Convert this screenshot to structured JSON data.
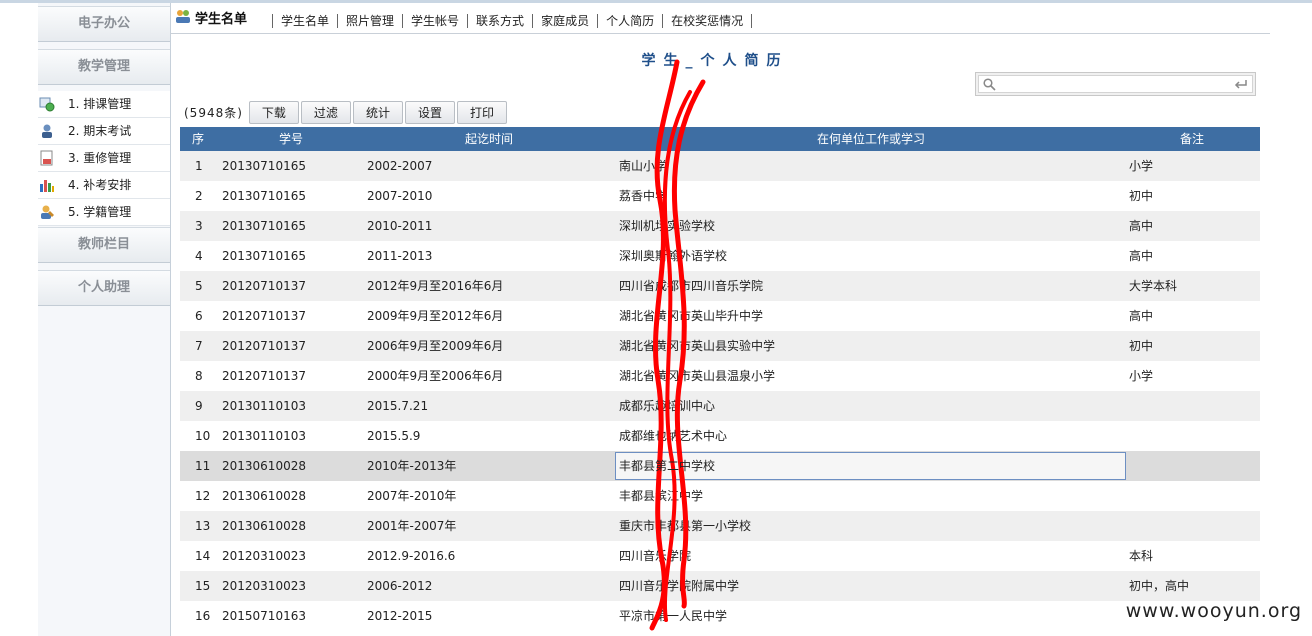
{
  "sidebar": {
    "sections": [
      {
        "label": "电子办公"
      },
      {
        "label": "教学管理"
      },
      {
        "label": "教师栏目"
      },
      {
        "label": "个人助理"
      }
    ],
    "items": [
      {
        "label": "1. 排课管理",
        "icon": "schedule-icon"
      },
      {
        "label": "2. 期末考试",
        "icon": "exam-icon"
      },
      {
        "label": "3. 重修管理",
        "icon": "document-icon"
      },
      {
        "label": "4. 补考安排",
        "icon": "bar-chart-icon"
      },
      {
        "label": "5. 学籍管理",
        "icon": "student-icon"
      }
    ]
  },
  "header": {
    "title": "学生名单",
    "tabs": [
      "学生名单",
      "照片管理",
      "学生帐号",
      "联系方式",
      "家庭成员",
      "个人简历",
      "在校奖惩情况"
    ]
  },
  "page_heading": "学生_个人简历",
  "search": {
    "placeholder": "",
    "value": ""
  },
  "toolbar": {
    "count": "(5948条)",
    "buttons": [
      "下载",
      "过滤",
      "统计",
      "设置",
      "打印"
    ]
  },
  "table": {
    "columns": [
      "序",
      "学号",
      "起讫时间",
      "在何单位工作或学习",
      "备注"
    ],
    "rows": [
      {
        "no": "1",
        "id": "20130710165",
        "period": "2002-2007",
        "unit": "南山小学",
        "note": "小学"
      },
      {
        "no": "2",
        "id": "20130710165",
        "period": "2007-2010",
        "unit": "荔香中学",
        "note": "初中"
      },
      {
        "no": "3",
        "id": "20130710165",
        "period": "2010-2011",
        "unit": "深圳机场实验学校",
        "note": "高中"
      },
      {
        "no": "4",
        "id": "20130710165",
        "period": "2011-2013",
        "unit": "深圳奥斯翰外语学校",
        "note": "高中"
      },
      {
        "no": "5",
        "id": "20120710137",
        "period": "2012年9月至2016年6月",
        "unit": "四川省成都市四川音乐学院",
        "note": "大学本科"
      },
      {
        "no": "6",
        "id": "20120710137",
        "period": "2009年9月至2012年6月",
        "unit": "湖北省黄冈市英山毕升中学",
        "note": "高中"
      },
      {
        "no": "7",
        "id": "20120710137",
        "period": "2006年9月至2009年6月",
        "unit": "湖北省黄冈市英山县实验中学",
        "note": "初中"
      },
      {
        "no": "8",
        "id": "20120710137",
        "period": "2000年9月至2006年6月",
        "unit": "湖北省黄冈市英山县温泉小学",
        "note": "小学"
      },
      {
        "no": "9",
        "id": "20130110103",
        "period": "2015.7.21",
        "unit": "成都乐趣培训中心",
        "note": ""
      },
      {
        "no": "10",
        "id": "20130110103",
        "period": "2015.5.9",
        "unit": "成都维也纳艺术中心",
        "note": ""
      },
      {
        "no": "11",
        "id": "20130610028",
        "period": "2010年-2013年",
        "unit": "丰都县第二中学校",
        "note": ""
      },
      {
        "no": "12",
        "id": "20130610028",
        "period": "2007年-2010年",
        "unit": "丰都县滨江中学",
        "note": ""
      },
      {
        "no": "13",
        "id": "20130610028",
        "period": "2001年-2007年",
        "unit": "重庆市丰都县第一小学校",
        "note": ""
      },
      {
        "no": "14",
        "id": "20120310023",
        "period": "2012.9-2016.6",
        "unit": "四川音乐学院",
        "note": "本科"
      },
      {
        "no": "15",
        "id": "20120310023",
        "period": "2006-2012",
        "unit": "四川音乐学院附属中学",
        "note": "初中，高中"
      },
      {
        "no": "16",
        "id": "20150710163",
        "period": "2012-2015",
        "unit": "平凉市第一人民中学",
        "note": ""
      }
    ],
    "selected_row": "11"
  },
  "watermark": "www.wooyun.org",
  "colors": {
    "header_bg": "#3e6ea3",
    "heading_text": "#1f4f8a",
    "redaction": "#ff0000"
  }
}
